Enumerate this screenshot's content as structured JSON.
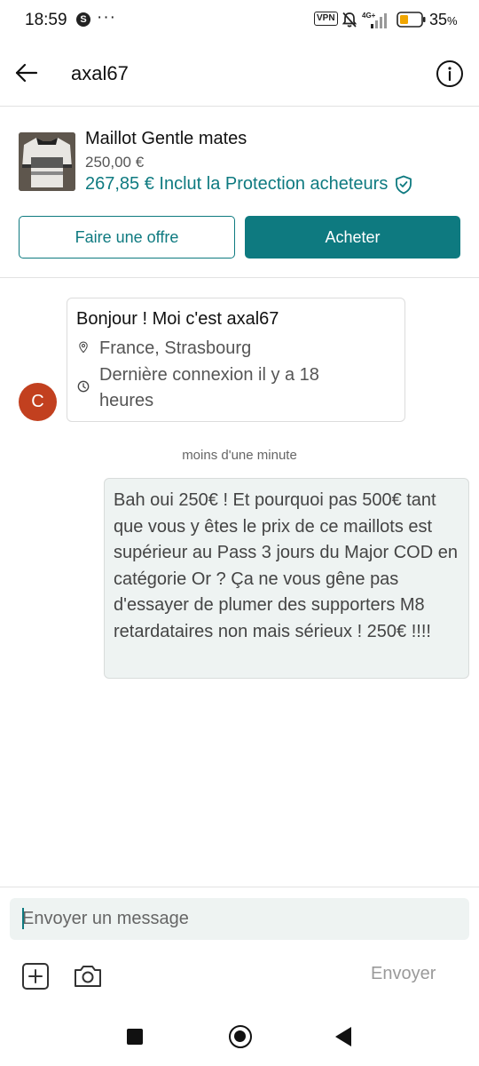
{
  "status_bar": {
    "time": "18:59",
    "app_badge": "S",
    "more": "···",
    "vpn": "VPN",
    "network": "4G+",
    "battery": "35",
    "battery_unit": "%"
  },
  "header": {
    "title": "axal67"
  },
  "item": {
    "title": "Maillot Gentle mates",
    "price": "250,00 €",
    "protected_price": "267,85 € Inclut la Protection acheteurs",
    "offer_label": "Faire une offre",
    "buy_label": "Acheter"
  },
  "profile_card": {
    "greeting": "Bonjour ! Moi c'est axal67",
    "location": "France, Strasbourg",
    "last_seen": "Dernière connexion il y a 18 heures",
    "avatar_letter": "C"
  },
  "chat": {
    "timestamp": "moins d'une minute",
    "message": "Bah oui 250€ ! Et pourquoi pas 500€ tant que vous y êtes le prix de ce maillots est supérieur au Pass 3 jours du Major COD en catégorie Or ? Ça ne vous gêne pas d'essayer de plumer des supporters M8 retardataires non mais sérieux ! 250€ !!!!"
  },
  "composer": {
    "placeholder": "Envoyer un message",
    "send_label": "Envoyer"
  },
  "colors": {
    "accent": "#0e7a80",
    "avatar": "#c2401f",
    "bubble": "#eef3f2"
  },
  "icons": [
    "back-arrow-icon",
    "info-icon",
    "shield-check-icon",
    "location-pin-icon",
    "clock-icon",
    "plus-icon",
    "camera-icon"
  ]
}
